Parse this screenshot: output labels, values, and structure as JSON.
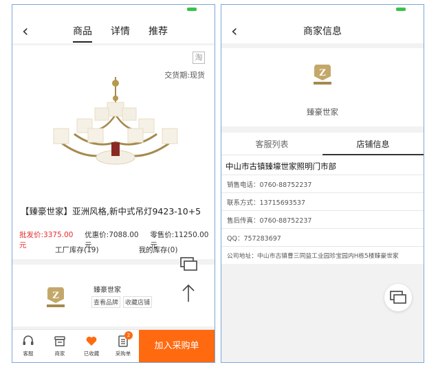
{
  "left_screen": {
    "nav": {
      "back": "‹",
      "tabs": [
        "商品",
        "详情",
        "推荐"
      ],
      "active_tab": 0
    },
    "tao_badge": "淘",
    "delivery": "交货期:现货",
    "product_title": "【臻豪世家】亚洲风格,新中式吊灯9423-10+5",
    "prices": {
      "wholesale": "批发价:3375.00元",
      "discount": "优惠价:7088.00元",
      "retail": "零售价:11250.00元"
    },
    "stock": {
      "factory": "工厂库存(19)",
      "mine": "我的库存(0)"
    },
    "shop": {
      "name": "臻豪世家",
      "view_brand": "查看品牌",
      "favorite_shop": "收藏店铺"
    },
    "bottom_bar": {
      "items": [
        {
          "label": "客服",
          "icon": "headset-icon"
        },
        {
          "label": "商家",
          "icon": "store-icon"
        },
        {
          "label": "已收藏",
          "icon": "heart-icon"
        },
        {
          "label": "采购单",
          "icon": "list-icon",
          "badge": "2"
        }
      ],
      "add_button": "加入采购单"
    },
    "colors": {
      "accent": "#ff6a10",
      "price_red": "#e32c2c",
      "brand_gold": "#a58a4e"
    }
  },
  "right_screen": {
    "nav": {
      "back": "‹",
      "title": "商家信息"
    },
    "shop_name": "臻豪世家",
    "tabs": [
      "客服列表",
      "店铺信息"
    ],
    "active_tab": 1,
    "company": "中山市古镇臻壕世家照明门市部",
    "rows": [
      "销售电话：0760-88752237",
      "联系方式：13715693537",
      "售后传真：0760-88752237",
      "QQ：757283697",
      "公司地址：中山市古镇曹三同益工业园珍宝园内H栋5楼臻豪世家"
    ]
  }
}
